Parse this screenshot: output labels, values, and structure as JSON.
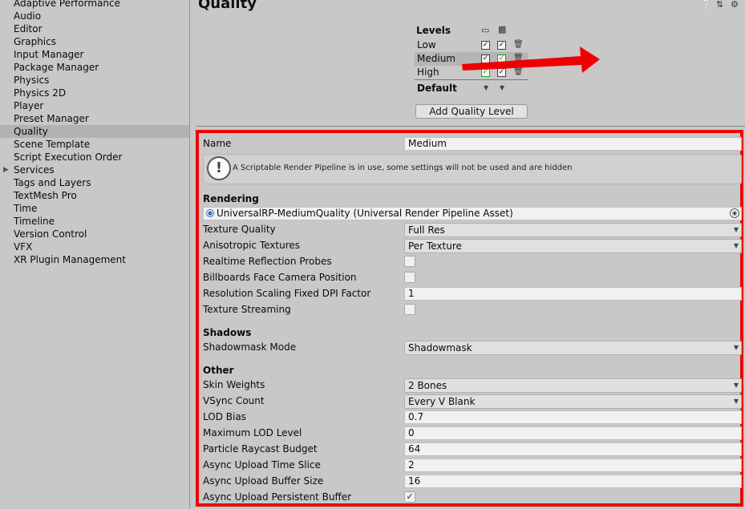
{
  "sidebar": {
    "items": [
      {
        "label": "Adaptive Performance"
      },
      {
        "label": "Audio"
      },
      {
        "label": "Editor"
      },
      {
        "label": "Graphics"
      },
      {
        "label": "Input Manager"
      },
      {
        "label": "Package Manager"
      },
      {
        "label": "Physics"
      },
      {
        "label": "Physics 2D"
      },
      {
        "label": "Player"
      },
      {
        "label": "Preset Manager"
      },
      {
        "label": "Quality",
        "selected": true
      },
      {
        "label": "Scene Template"
      },
      {
        "label": "Script Execution Order"
      },
      {
        "label": "Services",
        "expandable": true
      },
      {
        "label": "Tags and Layers"
      },
      {
        "label": "TextMesh Pro"
      },
      {
        "label": "Time"
      },
      {
        "label": "Timeline"
      },
      {
        "label": "Version Control"
      },
      {
        "label": "VFX"
      },
      {
        "label": "XR Plugin Management"
      }
    ]
  },
  "header": {
    "title": "Quality",
    "icons": [
      "help-icon",
      "preset-icon",
      "gear-icon"
    ]
  },
  "levels": {
    "title": "Levels",
    "platform_icons": [
      "monitor-icon",
      "android-icon"
    ],
    "rows": [
      {
        "label": "Low",
        "standalone": true,
        "android": true
      },
      {
        "label": "Medium",
        "standalone": true,
        "android": true,
        "selected": true
      },
      {
        "label": "High",
        "standalone": true,
        "android": true
      }
    ],
    "default_label": "Default",
    "add_button": "Add Quality Level"
  },
  "settings": {
    "name_label": "Name",
    "name_value": "Medium",
    "info_text": "A Scriptable Render Pipeline is in use, some settings will not be used and are hidden",
    "rendering_header": "Rendering",
    "pipeline_asset": "UniversalRP-MediumQuality (Universal Render Pipeline Asset)",
    "texture_quality_label": "Texture Quality",
    "texture_quality_value": "Full Res",
    "anisotropic_label": "Anisotropic Textures",
    "anisotropic_value": "Per Texture",
    "realtime_reflection_label": "Realtime Reflection Probes",
    "realtime_reflection_checked": false,
    "billboards_label": "Billboards Face Camera Position",
    "billboards_checked": false,
    "dpi_label": "Resolution Scaling Fixed DPI Factor",
    "dpi_value": "1",
    "texture_streaming_label": "Texture Streaming",
    "texture_streaming_checked": false,
    "shadows_header": "Shadows",
    "shadowmask_label": "Shadowmask Mode",
    "shadowmask_value": "Shadowmask",
    "other_header": "Other",
    "skin_weights_label": "Skin Weights",
    "skin_weights_value": "2 Bones",
    "vsync_label": "VSync Count",
    "vsync_value": "Every V Blank",
    "lod_bias_label": "LOD Bias",
    "lod_bias_value": "0.7",
    "max_lod_label": "Maximum LOD Level",
    "max_lod_value": "0",
    "particle_budget_label": "Particle Raycast Budget",
    "particle_budget_value": "64",
    "upload_time_label": "Async Upload Time Slice",
    "upload_time_value": "2",
    "upload_buffer_label": "Async Upload Buffer Size",
    "upload_buffer_value": "16",
    "persistent_buffer_label": "Async Upload Persistent Buffer",
    "persistent_buffer_checked": true
  },
  "colors": {
    "highlight_border": "#ef0000",
    "arrow": "#ef0000",
    "check_green": "#1aaa1a"
  }
}
